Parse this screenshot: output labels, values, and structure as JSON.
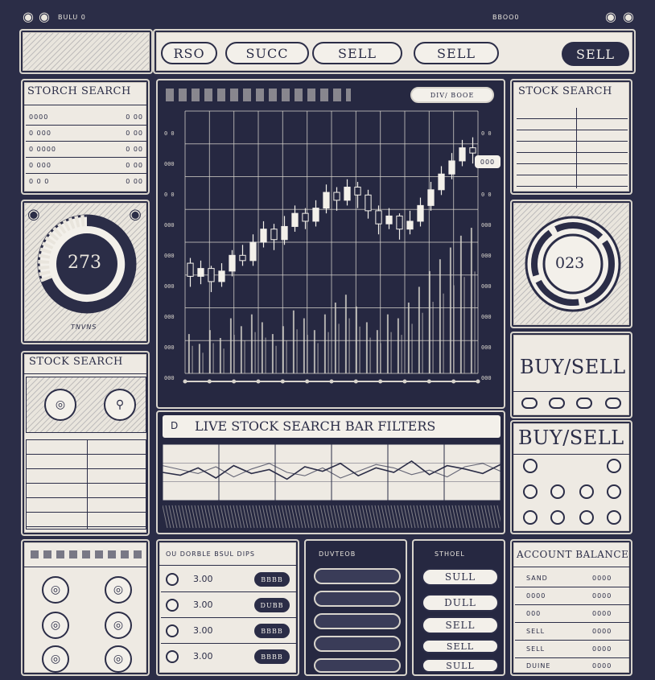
{
  "titlebar": {
    "text": "BULU 0",
    "right_text": "BBOO0"
  },
  "tabs": [
    {
      "label": "RSO"
    },
    {
      "label": "SUCC"
    },
    {
      "label": "SELL"
    },
    {
      "label": "SELL"
    },
    {
      "label": "SELL"
    }
  ],
  "left_search": {
    "title": "STORCH SEARCH",
    "rows": [
      {
        "name": "0000",
        "value": "0 00"
      },
      {
        "name": "0 000",
        "value": "0 00"
      },
      {
        "name": "0 0000",
        "value": "0 00"
      },
      {
        "name": "0 000",
        "value": "0 00"
      },
      {
        "name": "0 0 0",
        "value": "0 00"
      }
    ]
  },
  "left_gauge": {
    "value": "273",
    "caption": "TNVNS"
  },
  "left_stock": {
    "title": "STOCK SEARCH"
  },
  "chart": {
    "toolbar_button": "DIV/ BOOE",
    "price_tag": "000",
    "y_ticks": [
      "0 0",
      "000",
      "0 0",
      "000",
      "000",
      "000",
      "000",
      "000",
      "000"
    ]
  },
  "live_bar": {
    "title": "LIVE STOCK SEARCH BAR FILTERS",
    "icon": "D"
  },
  "right_search": {
    "title": "STOCK SEARCH"
  },
  "right_gauge": {
    "value": "023"
  },
  "buy_sell_1": {
    "title": "BUY/SELL"
  },
  "buy_sell_2": {
    "title": "BUY/SELL"
  },
  "orders": {
    "header": "OU DORBLE BSUL DIPS",
    "rows": [
      {
        "price": "3.00",
        "action": "BBBB"
      },
      {
        "price": "3.00",
        "action": "DUBB"
      },
      {
        "price": "3.00",
        "action": "BBBB"
      },
      {
        "price": "3.00",
        "action": "BBBB"
      }
    ]
  },
  "mid_panel": {
    "header": "DUVTEOB"
  },
  "action_panel": {
    "header": "STHOEL",
    "buttons": [
      "SULL",
      "DULL",
      "SELL",
      "SELL",
      "SULL"
    ]
  },
  "account": {
    "title": "ACCOUNT BALANCE",
    "rows": [
      {
        "label": "SAND",
        "value": "0000"
      },
      {
        "label": "0000",
        "value": "0000"
      },
      {
        "label": "000",
        "value": "0000"
      },
      {
        "label": "SELL",
        "value": "0000"
      },
      {
        "label": "SELL",
        "value": "0000"
      },
      {
        "label": "DUINE",
        "value": "0000"
      }
    ]
  },
  "chart_data": {
    "type": "candlestick",
    "candles": [
      [
        0.42,
        0.37,
        0.44,
        0.33
      ],
      [
        0.37,
        0.4,
        0.43,
        0.34
      ],
      [
        0.4,
        0.35,
        0.41,
        0.31
      ],
      [
        0.35,
        0.39,
        0.42,
        0.33
      ],
      [
        0.39,
        0.45,
        0.47,
        0.37
      ],
      [
        0.45,
        0.43,
        0.49,
        0.41
      ],
      [
        0.43,
        0.5,
        0.53,
        0.41
      ],
      [
        0.5,
        0.55,
        0.58,
        0.48
      ],
      [
        0.55,
        0.51,
        0.57,
        0.47
      ],
      [
        0.51,
        0.56,
        0.6,
        0.49
      ],
      [
        0.56,
        0.61,
        0.64,
        0.54
      ],
      [
        0.61,
        0.58,
        0.63,
        0.55
      ],
      [
        0.58,
        0.63,
        0.66,
        0.56
      ],
      [
        0.63,
        0.69,
        0.72,
        0.61
      ],
      [
        0.69,
        0.66,
        0.71,
        0.62
      ],
      [
        0.66,
        0.71,
        0.74,
        0.64
      ],
      [
        0.71,
        0.68,
        0.73,
        0.63
      ],
      [
        0.68,
        0.62,
        0.7,
        0.59
      ],
      [
        0.62,
        0.57,
        0.64,
        0.53
      ],
      [
        0.57,
        0.6,
        0.63,
        0.55
      ],
      [
        0.6,
        0.55,
        0.61,
        0.51
      ],
      [
        0.55,
        0.58,
        0.62,
        0.53
      ],
      [
        0.58,
        0.64,
        0.67,
        0.56
      ],
      [
        0.64,
        0.7,
        0.73,
        0.62
      ],
      [
        0.7,
        0.76,
        0.79,
        0.68
      ],
      [
        0.76,
        0.81,
        0.84,
        0.74
      ],
      [
        0.81,
        0.86,
        0.89,
        0.79
      ],
      [
        0.86,
        0.84,
        0.9,
        0.8
      ]
    ],
    "volume": [
      0.2,
      0.15,
      0.22,
      0.18,
      0.28,
      0.24,
      0.3,
      0.26,
      0.2,
      0.24,
      0.32,
      0.28,
      0.22,
      0.3,
      0.36,
      0.4,
      0.34,
      0.26,
      0.22,
      0.3,
      0.28,
      0.36,
      0.44,
      0.52,
      0.58,
      0.64,
      0.7,
      0.74
    ],
    "mini_series": [
      [
        0.5,
        0.45,
        0.58,
        0.4,
        0.62,
        0.48,
        0.55,
        0.38,
        0.6,
        0.52,
        0.66,
        0.44,
        0.58,
        0.5,
        0.7,
        0.46,
        0.62,
        0.56,
        0.48,
        0.64
      ],
      [
        0.62,
        0.55,
        0.48,
        0.6,
        0.42,
        0.56,
        0.66,
        0.5,
        0.44,
        0.58,
        0.4,
        0.52,
        0.64,
        0.58,
        0.46,
        0.54,
        0.42,
        0.6,
        0.66,
        0.52
      ]
    ]
  }
}
